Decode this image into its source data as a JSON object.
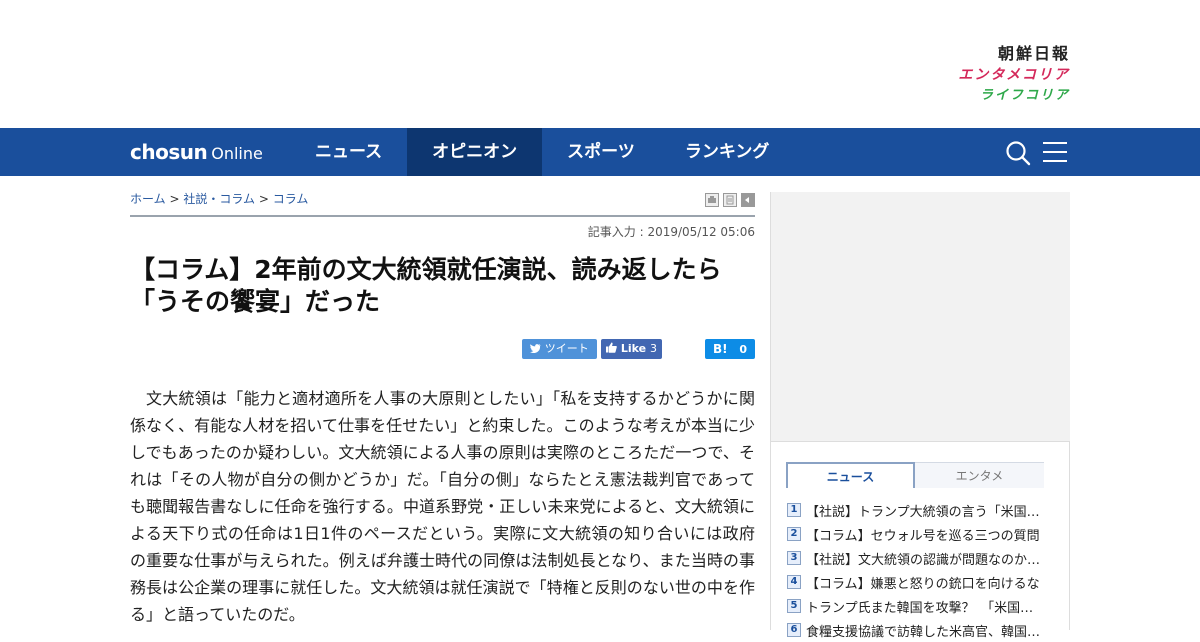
{
  "brand": {
    "chosun": "朝鮮日報",
    "entame": "エンタメコリア",
    "life": "ライフコリア"
  },
  "nav": {
    "logo_bold": "chosun",
    "logo_light": "Online",
    "items": [
      {
        "label": "ニュース"
      },
      {
        "label": "オピニオン"
      },
      {
        "label": "スポーツ"
      },
      {
        "label": "ランキング"
      }
    ],
    "active_index": 1
  },
  "breadcrumb": {
    "home": "ホーム",
    "sep": ">",
    "section": "社説・コラム",
    "current": "コラム"
  },
  "article": {
    "date": "記事入力 : 2019/05/12 05:06",
    "title_line1": "【コラム】2年前の文大統領就任演説、読み返したら",
    "title_line2": "「うその饗宴」だった",
    "body": "文大統領は「能力と適材適所を人事の大原則としたい」「私を支持するかどうかに関係なく、有能な人材を招いて仕事を任せたい」と約束した。このような考えが本当に少しでもあったのか疑わしい。文大統領による人事の原則は実際のところただ一つで、それは「その人物が自分の側かどうか」だ。「自分の側」ならたとえ憲法裁判官であっても聴聞報告書なしに任命を強行する。中道系野党・正しい未来党によると、文大統領による天下り式の任命は1日1件のペースだという。実際に文大統領の知り合いには政府の重要な仕事が与えられた。例えば弁護士時代の同僚は法制処長となり、また当時の事務長は公企業の理事に就任した。文大統領は就任演説で「特権と反則のない世の中を作る」と語っていたのだ。"
  },
  "share": {
    "tweet": "ツイート",
    "like": "Like",
    "like_count": "3",
    "hatena": "B!",
    "hatena_count": "0"
  },
  "ranking": {
    "tabs": [
      "ニュース",
      "エンタメ"
    ],
    "items": [
      {
        "num": "1",
        "text": "【社説】トランプ大統領の言う「米国…"
      },
      {
        "num": "2",
        "text": "【コラム】セウォル号を巡る三つの質問"
      },
      {
        "num": "3",
        "text": "【社説】文大統領の認識が問題なのか…"
      },
      {
        "num": "4",
        "text": "【コラム】嫌悪と怒りの銃口を向けるな"
      },
      {
        "num": "5",
        "text": "トランプ氏また韓国を攻撃？　「米国…"
      },
      {
        "num": "6",
        "text": "食糧支援協議で訪韓した米高官、韓国…"
      }
    ]
  },
  "colors": {
    "nav_bg": "#1a4f9c",
    "nav_active": "#0d3670",
    "entame": "#d4285a",
    "life": "#2ea84a"
  }
}
